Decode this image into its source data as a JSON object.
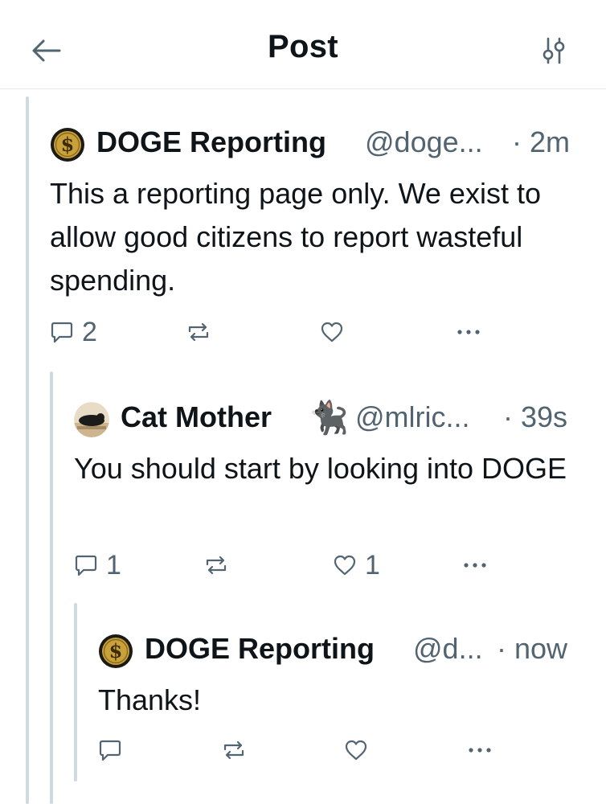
{
  "header": {
    "title": "Post",
    "back_icon": "back-arrow-icon",
    "filter_icon": "sliders-icon"
  },
  "posts": [
    {
      "name": "DOGE Reporting",
      "handle": "@doge...",
      "time": "· 2m",
      "body": "This a reporting page only. We exist to allow good citizens to report wasteful spending.",
      "replies": "2",
      "retweets": "",
      "likes": ""
    },
    {
      "name": "Cat Mother",
      "emoji": "🐈‍⬛",
      "handle": "@mlric...",
      "time": "· 39s",
      "body": "You should start by looking into DOGE",
      "replies": "1",
      "retweets": "",
      "likes": "1"
    },
    {
      "name": "DOGE Reporting",
      "handle": "@d...",
      "time": "· now",
      "body": "Thanks!",
      "replies": "",
      "retweets": "",
      "likes": ""
    }
  ],
  "colors": {
    "text_primary": "#0f1419",
    "text_secondary": "#536471",
    "icon_color": "#536471",
    "thread_line": "#cfd9de",
    "coin_gold": "#c9a13a"
  }
}
